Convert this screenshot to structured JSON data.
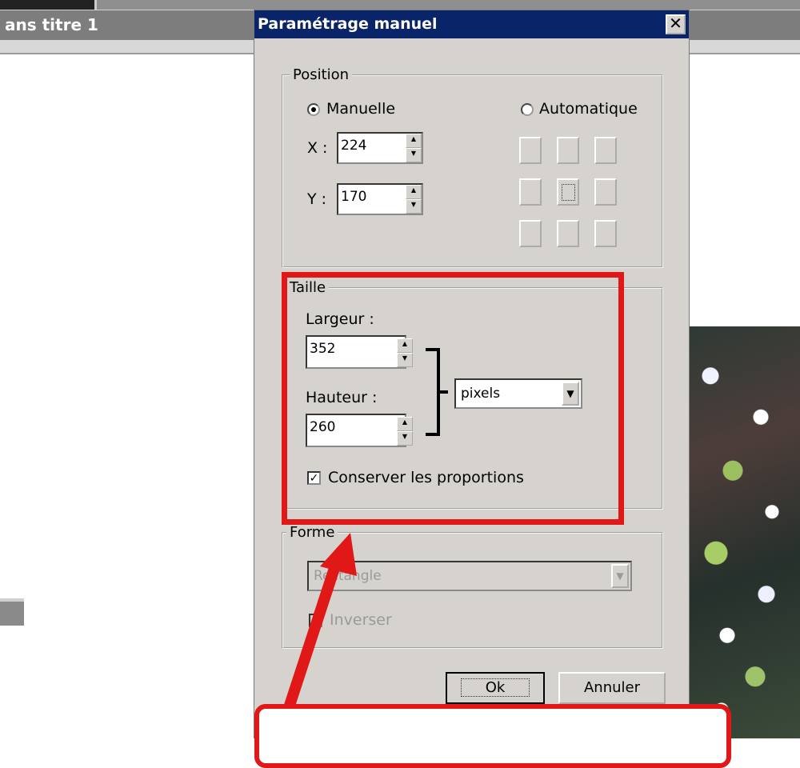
{
  "app": {
    "document_tab": "ans titre 1"
  },
  "dialog": {
    "title": "Paramétrage manuel",
    "close_glyph": "✕",
    "position": {
      "legend": "Position",
      "manual_label": "Manuelle",
      "auto_label": "Automatique",
      "x_label": "X :",
      "x_value": "224",
      "y_label": "Y :",
      "y_value": "170"
    },
    "size": {
      "legend": "Taille",
      "width_label": "Largeur :",
      "width_value": "352",
      "height_label": "Hauteur :",
      "height_value": "260",
      "unit_value": "pixels",
      "keep_ratio_label": "Conserver les proportions",
      "keep_ratio_checked": true
    },
    "shape": {
      "legend": "Forme",
      "shape_value": "Rectangle",
      "invert_label": "Inverser"
    },
    "ok_label": "Ok",
    "cancel_label": "Annuler"
  },
  "colors": {
    "title_bar": "#0a246a",
    "dialog_bg": "#d6d3ce",
    "annotation_red": "#e01818"
  },
  "icons": [
    "close-icon",
    "spin-up-icon",
    "spin-down-icon",
    "dropdown-arrow-icon",
    "check-icon",
    "radio-dot-icon"
  ]
}
